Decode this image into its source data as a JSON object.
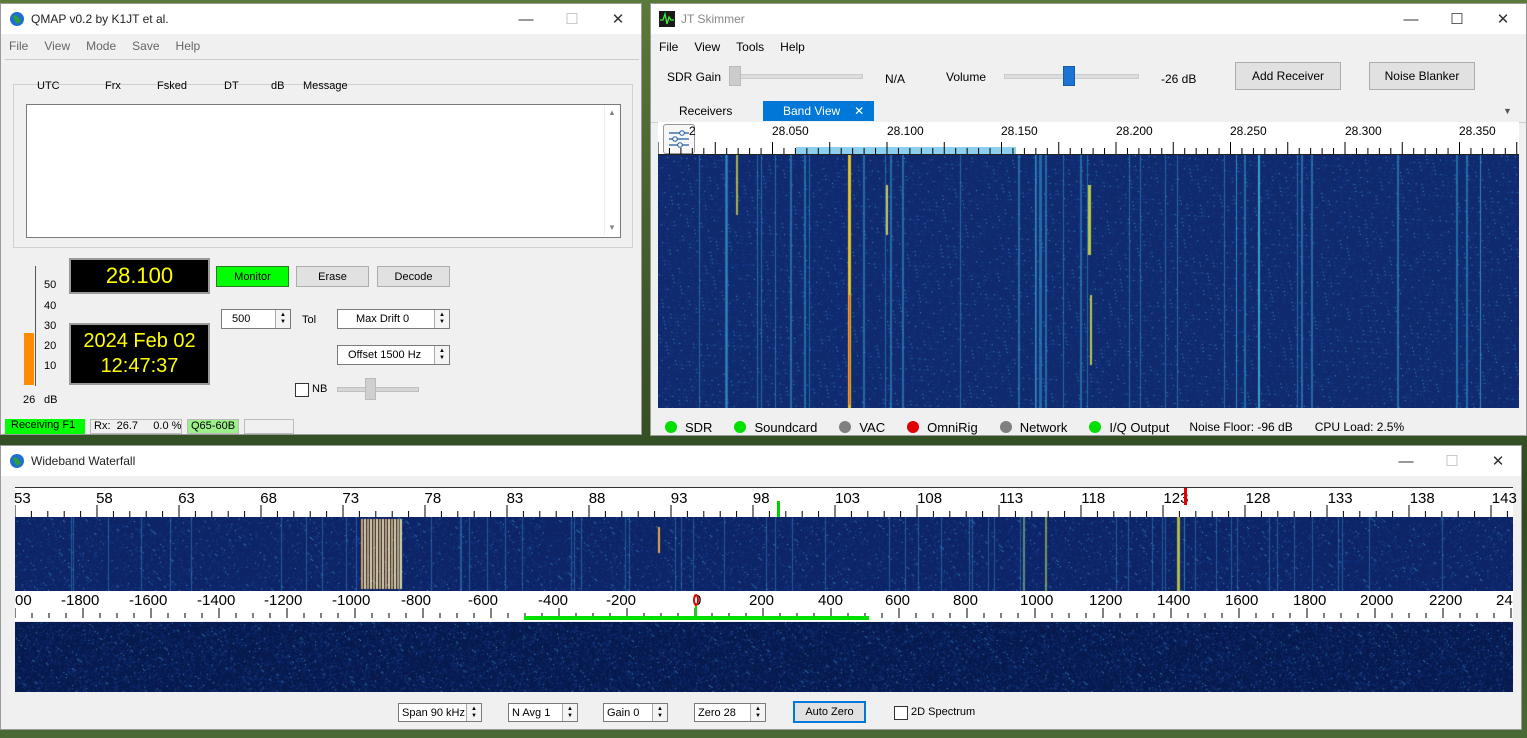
{
  "qmap": {
    "title": "QMAP   v0.2    by K1JT et al.",
    "menu": [
      "File",
      "View",
      "Mode",
      "Save",
      "Help"
    ],
    "columns": [
      "UTC",
      "Frx",
      "Fsked",
      "DT",
      "dB",
      "Message"
    ],
    "freq_display": "28.100",
    "date_display": "2024 Feb 02",
    "time_display": "12:47:37",
    "buttons": {
      "monitor": "Monitor",
      "erase": "Erase",
      "decode": "Decode"
    },
    "tol_value": "500",
    "tol_label": "Tol",
    "max_drift": "Max Drift  0",
    "offset": "Offset 1500 Hz",
    "nb_label": "NB",
    "meter_ticks": [
      "50",
      "40",
      "30",
      "20",
      "10"
    ],
    "meter_value_label": "26",
    "meter_unit": "dB",
    "meter_level_db": 26,
    "status": {
      "receiving": "Receiving F1",
      "rx": "Rx:  26.7     0.0 %",
      "mode": "Q65-60B"
    },
    "colors": {
      "monitor": "#00ff00",
      "lcd_text": "#ffff00",
      "meter": "#ff8c00"
    }
  },
  "skimmer": {
    "title": "JT Skimmer",
    "menu": [
      "File",
      "View",
      "Tools",
      "Help"
    ],
    "sdr_gain_label": "SDR Gain",
    "sdr_gain_value": "N/A",
    "volume_label": "Volume",
    "volume_value": "-26 dB",
    "buttons": {
      "add_receiver": "Add Receiver",
      "noise_blanker": "Noise Blanker"
    },
    "tabs": {
      "receivers": "Receivers",
      "band_view": "Band View"
    },
    "freq_ticks": [
      "28.050",
      "28.100",
      "28.150",
      "28.200",
      "28.250",
      "28.300",
      "28.350"
    ],
    "freq_edge_label": "2",
    "status_items": [
      {
        "label": "SDR",
        "color": "#00e000"
      },
      {
        "label": "Soundcard",
        "color": "#00e000"
      },
      {
        "label": "VAC",
        "color": "#808080"
      },
      {
        "label": "OmniRig",
        "color": "#e00000"
      },
      {
        "label": "Network",
        "color": "#808080"
      },
      {
        "label": "I/Q Output",
        "color": "#00e000"
      }
    ],
    "noise_floor": "Noise Floor: -96 dB",
    "cpu_load": "CPU Load: 2.5%"
  },
  "wideband": {
    "title": "Wideband Waterfall",
    "top_ticks": [
      "53",
      "58",
      "63",
      "68",
      "73",
      "78",
      "83",
      "88",
      "93",
      "98",
      "103",
      "108",
      "113",
      "118",
      "123",
      "128",
      "133",
      "138",
      "143"
    ],
    "mid_ticks": [
      "00",
      "-1800",
      "-1600",
      "-1400",
      "-1200",
      "-1000",
      "-800",
      "-600",
      "-400",
      "-200",
      "0",
      "200",
      "400",
      "600",
      "800",
      "1000",
      "1200",
      "1400",
      "1600",
      "1800",
      "2000",
      "2200",
      "24"
    ],
    "controls": {
      "span": "Span 90 kHz",
      "navg": "N Avg 1",
      "gain": "Gain 0",
      "zero": "Zero 28",
      "auto_zero": "Auto Zero",
      "spectrum_2d": "2D Spectrum"
    }
  }
}
